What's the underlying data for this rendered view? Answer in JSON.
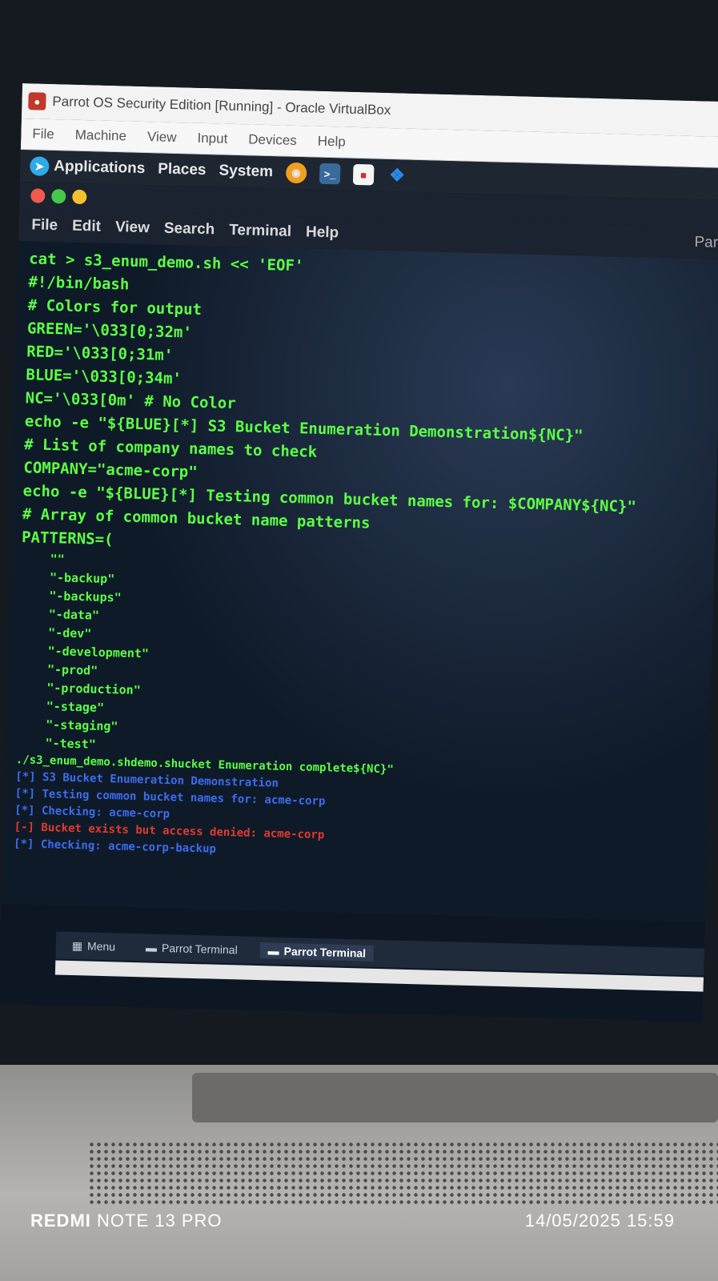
{
  "vbox": {
    "title": "Parrot OS Security Edition [Running] - Oracle VirtualBox",
    "menu": [
      "File",
      "Machine",
      "View",
      "Input",
      "Devices",
      "Help"
    ]
  },
  "desktop_panel": {
    "applications": "Applications",
    "places": "Places",
    "system": "System",
    "icons": [
      "firefox-icon",
      "terminal-launcher-icon",
      "file-icon",
      "vscode-icon"
    ]
  },
  "terminal": {
    "menu": [
      "File",
      "Edit",
      "View",
      "Search",
      "Terminal",
      "Help"
    ],
    "right_title": "Par",
    "lines": [
      "cat > s3_enum_demo.sh << 'EOF'",
      "#!/bin/bash",
      "",
      "# Colors for output",
      "GREEN='\\033[0;32m'",
      "RED='\\033[0;31m'",
      "BLUE='\\033[0;34m'",
      "NC='\\033[0m' # No Color",
      "",
      "echo -e \"${BLUE}[*] S3 Bucket Enumeration Demonstration${NC}\"",
      "",
      "# List of company names to check",
      "COMPANY=\"acme-corp\"",
      "echo -e \"${BLUE}[*] Testing common bucket names for: $COMPANY${NC}\"",
      "",
      "# Array of common bucket name patterns",
      "PATTERNS=("
    ],
    "pattern_lines": [
      "    \"\"",
      "    \"-backup\"",
      "    \"-backups\"",
      "    \"-data\"",
      "    \"-dev\"",
      "    \"-development\"",
      "    \"-prod\"",
      "    \"-production\"",
      "    \"-stage\"",
      "    \"-staging\"",
      "    \"-test\""
    ],
    "run_line": "./s3_enum_demo.shdemo.shucket Enumeration complete${NC}\"",
    "output": [
      {
        "text": "[*] S3 Bucket Enumeration Demonstration",
        "color": "blue"
      },
      {
        "text": "[*] Testing common bucket names for: acme-corp",
        "color": "blue"
      },
      {
        "text": "[*] Checking: acme-corp",
        "color": "blue"
      },
      {
        "text": "[-] Bucket exists but access denied: acme-corp",
        "color": "red"
      },
      {
        "text": "[*] Checking: acme-corp-backup",
        "color": "blue"
      }
    ]
  },
  "taskbar": {
    "menu": "Menu",
    "task1": "Parrot Terminal",
    "task2": "Parrot Terminal"
  },
  "watermark": {
    "brand": "REDMI",
    "model": "NOTE 13 PRO",
    "datetime": "14/05/2025 15:59"
  },
  "colors": {
    "green_text": "#5cff45",
    "blue_text": "#3c6cf0",
    "red_text": "#e23a2e"
  }
}
